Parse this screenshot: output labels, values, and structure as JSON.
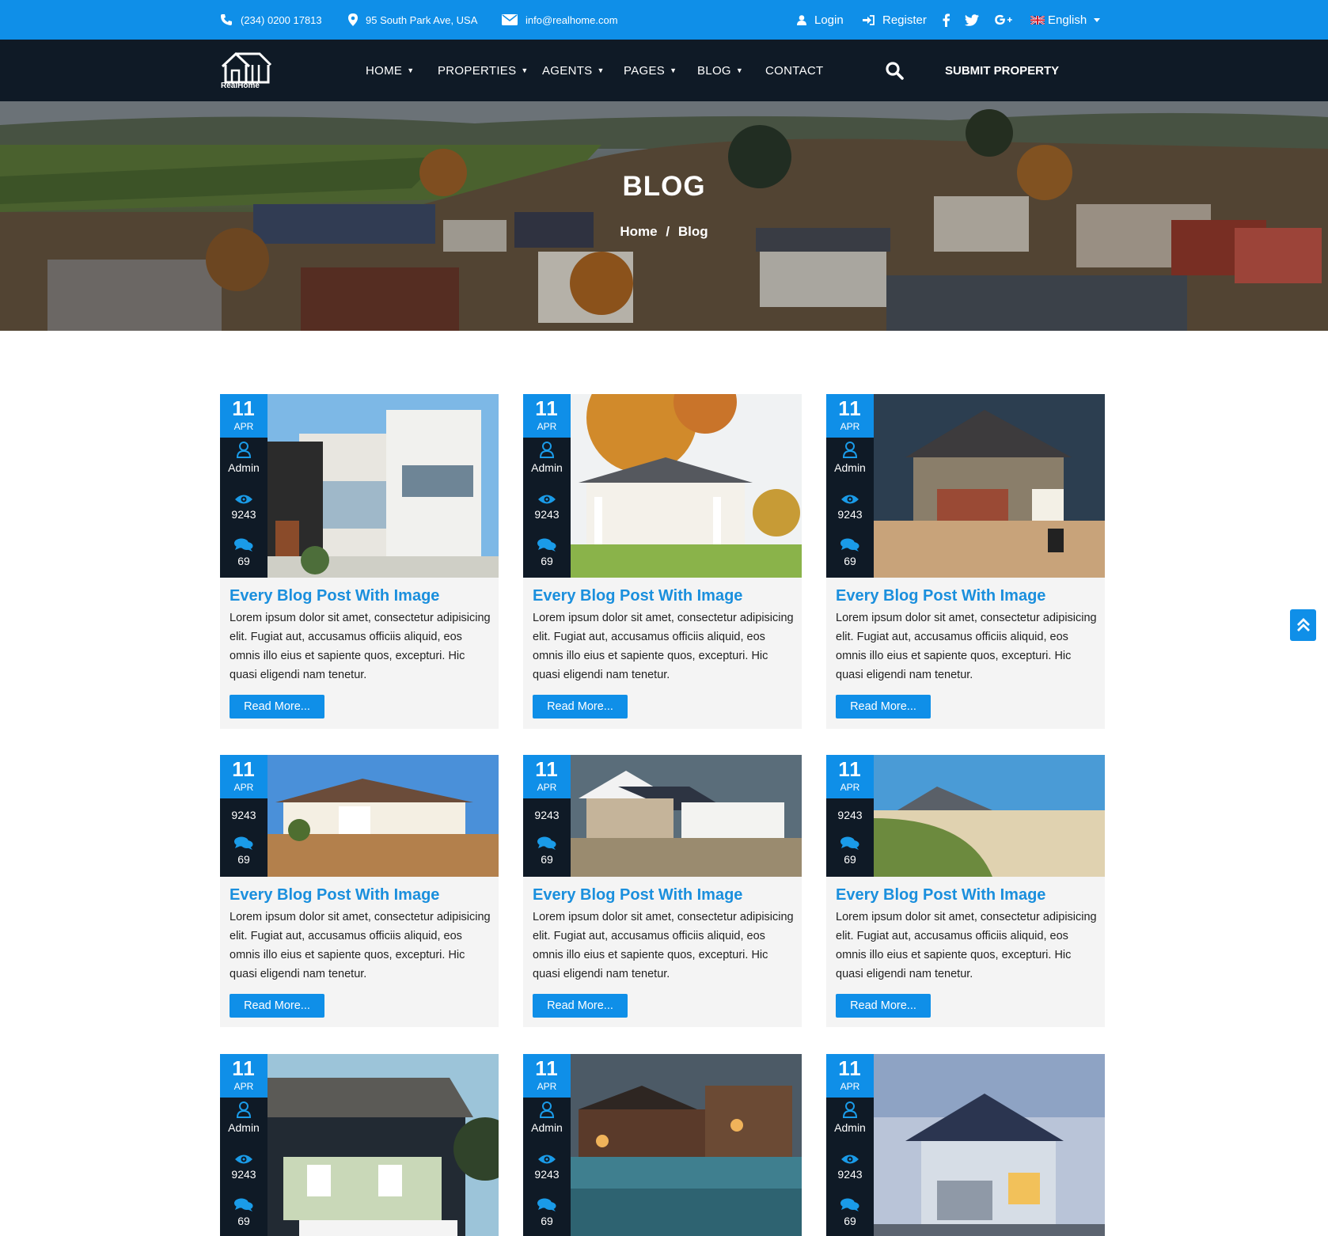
{
  "topbar": {
    "phone": "(234) 0200 17813",
    "address": "95 South Park Ave, USA",
    "email": "info@realhome.com",
    "login": "Login",
    "register": "Register",
    "language": "English"
  },
  "brand": {
    "name": "RealHome"
  },
  "nav": {
    "items": [
      {
        "label": "HOME"
      },
      {
        "label": "PROPERTIES"
      },
      {
        "label": "AGENTS"
      },
      {
        "label": "PAGES"
      },
      {
        "label": "BLOG"
      },
      {
        "label": "CONTACT"
      }
    ],
    "submit": "SUBMIT PROPERTY"
  },
  "hero": {
    "title": "BLOG",
    "crumb_home": "Home",
    "crumb_sep": "/",
    "crumb_current": "Blog"
  },
  "posts": [
    {
      "day": "11",
      "month": "APR",
      "author": "Admin",
      "views": "9243",
      "comments": "69",
      "title": "Every Blog Post With Image",
      "excerpt": "Lorem ipsum dolor sit amet, consectetur adipisicing elit. Fugiat aut, accusamus officiis aliquid, eos omnis illo eius et sapiente quos, excepturi. Hic quasi eligendi nam tenetur.",
      "button": "Read More..."
    },
    {
      "day": "11",
      "month": "APR",
      "author": "Admin",
      "views": "9243",
      "comments": "69",
      "title": "Every Blog Post With Image",
      "excerpt": "Lorem ipsum dolor sit amet, consectetur adipisicing elit. Fugiat aut, accusamus officiis aliquid, eos omnis illo eius et sapiente quos, excepturi. Hic quasi eligendi nam tenetur.",
      "button": "Read More..."
    },
    {
      "day": "11",
      "month": "APR",
      "author": "Admin",
      "views": "9243",
      "comments": "69",
      "title": "Every Blog Post With Image",
      "excerpt": "Lorem ipsum dolor sit amet, consectetur adipisicing elit. Fugiat aut, accusamus officiis aliquid, eos omnis illo eius et sapiente quos, excepturi. Hic quasi eligendi nam tenetur.",
      "button": "Read More..."
    },
    {
      "day": "11",
      "month": "APR",
      "views": "9243",
      "comments": "69",
      "title": "Every Blog Post With Image",
      "excerpt": "Lorem ipsum dolor sit amet, consectetur adipisicing elit. Fugiat aut, accusamus officiis aliquid, eos omnis illo eius et sapiente quos, excepturi. Hic quasi eligendi nam tenetur.",
      "button": "Read More..."
    },
    {
      "day": "11",
      "month": "APR",
      "views": "9243",
      "comments": "69",
      "title": "Every Blog Post With Image",
      "excerpt": "Lorem ipsum dolor sit amet, consectetur adipisicing elit. Fugiat aut, accusamus officiis aliquid, eos omnis illo eius et sapiente quos, excepturi. Hic quasi eligendi nam tenetur.",
      "button": "Read More..."
    },
    {
      "day": "11",
      "month": "APR",
      "views": "9243",
      "comments": "69",
      "title": "Every Blog Post With Image",
      "excerpt": "Lorem ipsum dolor sit amet, consectetur adipisicing elit. Fugiat aut, accusamus officiis aliquid, eos omnis illo eius et sapiente quos, excepturi. Hic quasi eligendi nam tenetur.",
      "button": "Read More..."
    },
    {
      "day": "11",
      "month": "APR",
      "author": "Admin",
      "views": "9243",
      "comments": "69"
    },
    {
      "day": "11",
      "month": "APR",
      "author": "Admin",
      "views": "9243",
      "comments": "69"
    },
    {
      "day": "11",
      "month": "APR",
      "author": "Admin",
      "views": "9243",
      "comments": "69"
    }
  ],
  "colors": {
    "primary": "#0f8fe8",
    "dark": "#0f1a26",
    "title": "#1a8fdd",
    "card_bg": "#f4f4f4"
  }
}
